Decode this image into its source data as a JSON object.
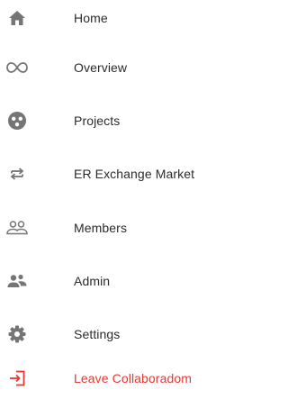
{
  "nav": {
    "items": [
      {
        "label": "Home",
        "icon": "home-icon"
      },
      {
        "label": "Overview",
        "icon": "infinity-icon"
      },
      {
        "label": "Projects",
        "icon": "projects-icon"
      },
      {
        "label": "ER Exchange Market",
        "icon": "swap-arrows-icon"
      },
      {
        "label": "Members",
        "icon": "members-icon"
      },
      {
        "label": "Admin",
        "icon": "admin-icon"
      },
      {
        "label": "Settings",
        "icon": "gear-icon"
      },
      {
        "label": "Leave Collaboradom",
        "icon": "exit-icon"
      }
    ]
  },
  "colors": {
    "icon": "#757575",
    "text": "#2b2b2b",
    "danger": "#e53935"
  }
}
